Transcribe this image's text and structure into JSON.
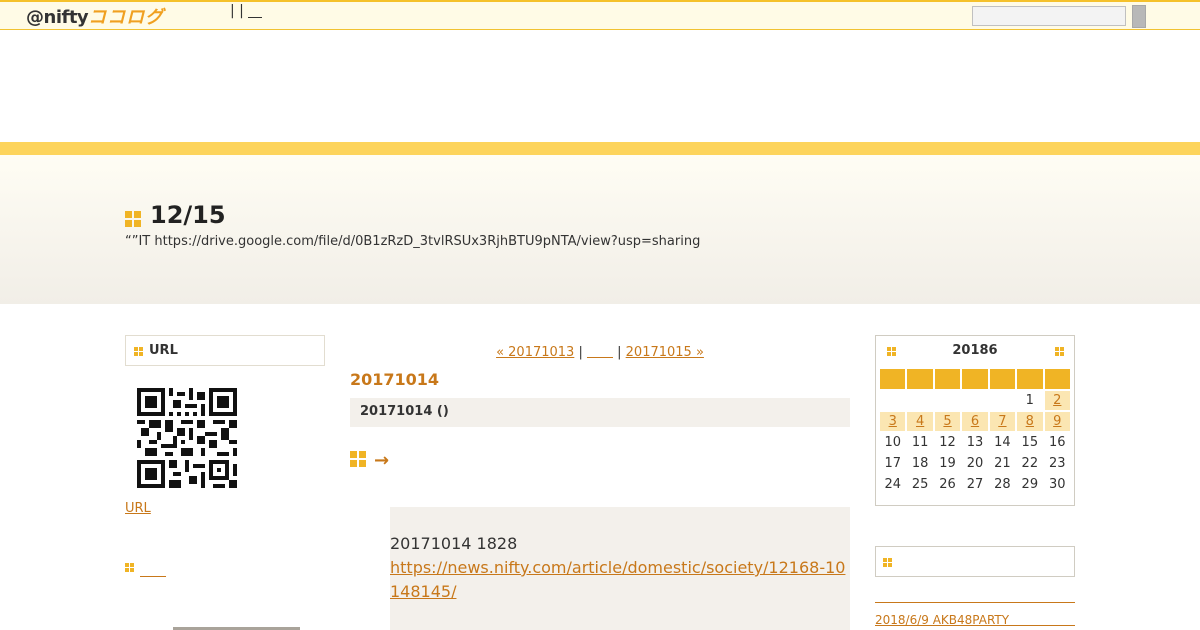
{
  "header": {
    "logo_text": "@nifty",
    "logo_brand": "ココログ",
    "links": [
      "|",
      "|"
    ],
    "search": {
      "value": "",
      "button_label": ""
    }
  },
  "blog": {
    "title": "12/15",
    "description": "“”IT  https://drive.google.com/file/d/0B1zRzD_3tvlRSUx3RjhBTU9pNTA/view?usp=sharing"
  },
  "left_sidebar": {
    "qr_heading": "URL",
    "url_link": "URL",
    "item_link": "＿＿"
  },
  "main": {
    "nav": {
      "prev": "« 20171013",
      "sep1": " | ",
      "home": "＿＿",
      "sep2": " | ",
      "next": "20171015 » "
    },
    "date_heading": "20171014",
    "entry_title": "20171014 ()",
    "entry_arrow": "→",
    "entry_text": "20171014 1828",
    "entry_link": "https://news.nifty.com/article/domestic/society/12168-10148145/"
  },
  "calendar": {
    "title": "20186",
    "weeks": [
      [
        {
          "d": ""
        },
        {
          "d": ""
        },
        {
          "d": ""
        },
        {
          "d": ""
        },
        {
          "d": ""
        },
        {
          "d": "1"
        },
        {
          "d": "2",
          "link": true
        }
      ],
      [
        {
          "d": "3",
          "link": true
        },
        {
          "d": "4",
          "link": true
        },
        {
          "d": "5",
          "link": true
        },
        {
          "d": "6",
          "link": true
        },
        {
          "d": "7",
          "link": true
        },
        {
          "d": "8",
          "link": true
        },
        {
          "d": "9",
          "link": true
        }
      ],
      [
        {
          "d": "10"
        },
        {
          "d": "11"
        },
        {
          "d": "12"
        },
        {
          "d": "13"
        },
        {
          "d": "14"
        },
        {
          "d": "15"
        },
        {
          "d": "16"
        }
      ],
      [
        {
          "d": "17"
        },
        {
          "d": "18"
        },
        {
          "d": "19"
        },
        {
          "d": "20"
        },
        {
          "d": "21"
        },
        {
          "d": "22"
        },
        {
          "d": "23"
        }
      ],
      [
        {
          "d": "24"
        },
        {
          "d": "25"
        },
        {
          "d": "26"
        },
        {
          "d": "27"
        },
        {
          "d": "28"
        },
        {
          "d": "29"
        },
        {
          "d": "30"
        }
      ]
    ]
  },
  "right_sidebar": {
    "recent_link": "2018/6/9 AKB48PARTY"
  },
  "colors": {
    "accent": "#f0b425",
    "link": "#c8781a",
    "stripe": "#fdd45c"
  }
}
